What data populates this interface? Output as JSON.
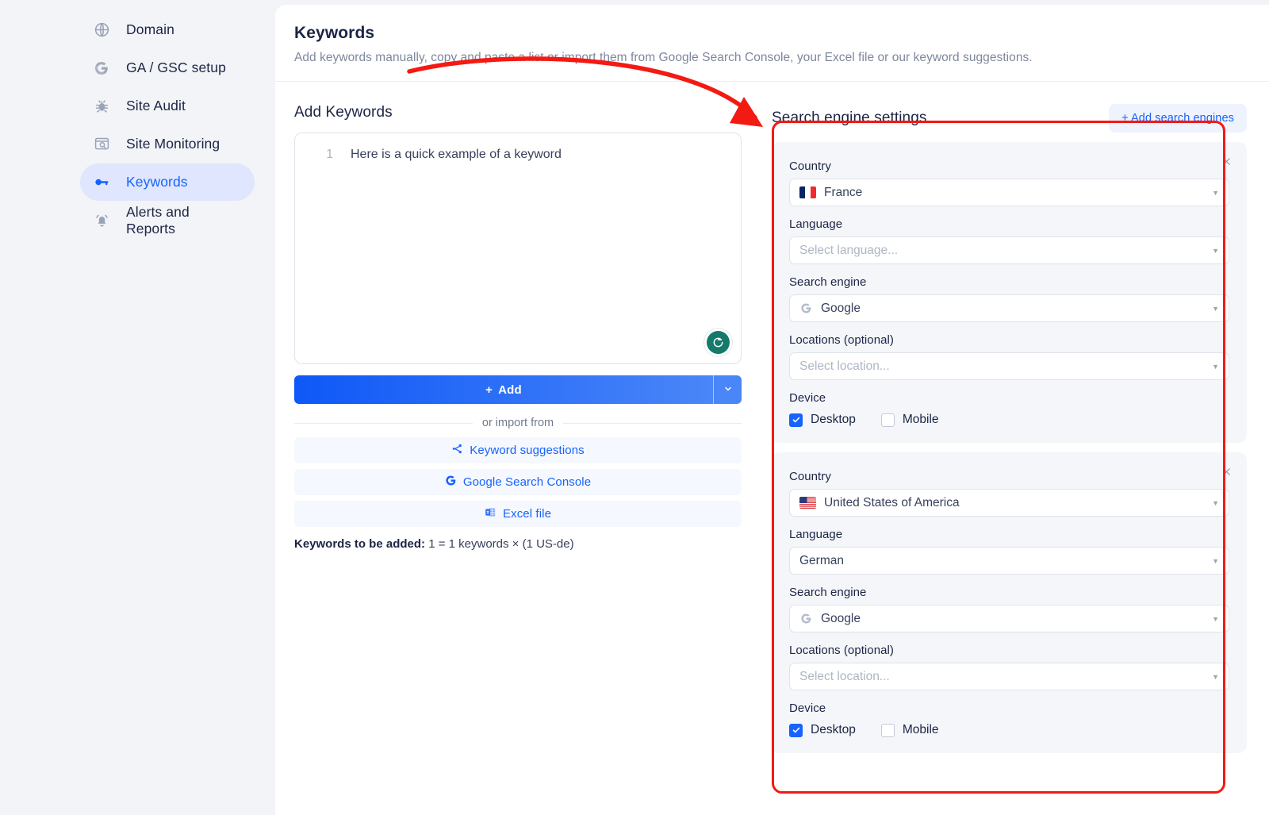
{
  "sidebar": {
    "items": [
      {
        "label": "Domain",
        "icon": "globe-icon",
        "active": false
      },
      {
        "label": "GA / GSC setup",
        "icon": "google-icon",
        "active": false
      },
      {
        "label": "Site Audit",
        "icon": "bug-icon",
        "active": false
      },
      {
        "label": "Site Monitoring",
        "icon": "monitor-search-icon",
        "active": false
      },
      {
        "label": "Keywords",
        "icon": "key-icon",
        "active": true
      },
      {
        "label": "Alerts and Reports",
        "icon": "bell-icon",
        "active": false
      }
    ]
  },
  "page": {
    "title": "Keywords",
    "subtitle": "Add keywords manually, copy and paste a list or import them from Google Search Console, your Excel file or our keyword suggestions."
  },
  "add_keywords": {
    "section_title": "Add Keywords",
    "editor": {
      "lines": [
        {
          "number": "1",
          "text": "Here is a quick example of a keyword"
        }
      ],
      "grammarly_icon": "grammarly-icon"
    },
    "add_button": {
      "label": "Add",
      "plus": "+",
      "caret": "chevron-down-icon"
    },
    "divider_label": "or import from",
    "import_buttons": [
      {
        "label": "Keyword suggestions",
        "icon": "share-nodes-icon"
      },
      {
        "label": "Google Search Console",
        "icon": "google-icon"
      },
      {
        "label": "Excel file",
        "icon": "excel-icon"
      }
    ],
    "summary": {
      "prefix": "Keywords to be added:",
      "value": " 1 = 1 keywords × (1 US-de)"
    }
  },
  "search_engine_settings": {
    "title": "Search engine settings",
    "add_button": {
      "label": "Add search engines",
      "plus": "+"
    },
    "labels": {
      "country": "Country",
      "language": "Language",
      "search_engine": "Search engine",
      "locations": "Locations (optional)",
      "device": "Device",
      "desktop": "Desktop",
      "mobile": "Mobile",
      "close": "close-icon"
    },
    "cards": [
      {
        "country": {
          "value": "France",
          "flag": "fr"
        },
        "language": {
          "value": "Select language...",
          "placeholder": true
        },
        "engine": {
          "value": "Google",
          "icon": "google-icon"
        },
        "location": {
          "value": "Select location...",
          "placeholder": true
        },
        "desktop_checked": true,
        "mobile_checked": false
      },
      {
        "country": {
          "value": "United States of America",
          "flag": "us"
        },
        "language": {
          "value": "German",
          "placeholder": false
        },
        "engine": {
          "value": "Google",
          "icon": "google-icon"
        },
        "location": {
          "value": "Select location...",
          "placeholder": true
        },
        "desktop_checked": true,
        "mobile_checked": false
      }
    ]
  },
  "annotation": {
    "highlight_color": "#f31a13",
    "arrow": "curved-arrow-annotation"
  },
  "colors": {
    "accent": "#1763fd",
    "text": "#1c2545",
    "muted": "#7d879c",
    "annotation": "#f31a13"
  }
}
